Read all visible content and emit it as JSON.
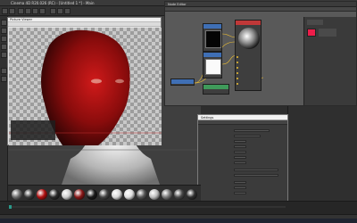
{
  "app": {
    "window_title": "Cinema 4D R20.026 (RC) - [Untitled 1 *] - Main",
    "colors": {
      "background": "#2b2b2b",
      "viewport": "#3f3f3f",
      "node_head_blue": "#3f6fb5",
      "node_head_red": "#c03838",
      "node_head_green": "#3f9a5a",
      "red_swatch": "#ee1d4a"
    }
  },
  "window_controls": [
    "minimize-icon",
    "maximize-icon",
    "close-icon"
  ],
  "picture_viewer": {
    "title": "Picture Viewer"
  },
  "node_editor": {
    "title": "Node Editor"
  },
  "dialog": {
    "title": "Settings"
  },
  "materials": {
    "swatches": [
      {
        "color": "#6b6b6b"
      },
      {
        "color": "#3a3a3a"
      },
      {
        "color": "#b01010"
      },
      {
        "color": "#2a2a2a"
      },
      {
        "color": "#cfcfcf"
      },
      {
        "color": "#8a1818"
      },
      {
        "color": "#1a1a1a"
      },
      {
        "color": "#444444"
      },
      {
        "color": "#d9d9d9"
      },
      {
        "color": "#e0e0e0"
      },
      {
        "color": "#555555"
      },
      {
        "color": "#bdbdbd"
      },
      {
        "color": "#777777"
      },
      {
        "color": "#4a4a4a"
      },
      {
        "color": "#2f2f2f"
      }
    ]
  }
}
